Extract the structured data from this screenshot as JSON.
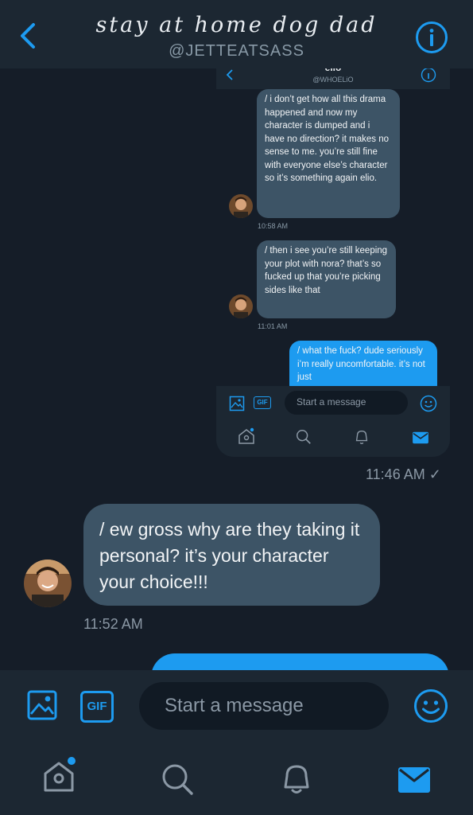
{
  "header": {
    "title": "stay at home dog dad",
    "handle": "@JETTEATSASS"
  },
  "embedded": {
    "title": "elio",
    "handle": "@WHOELiO",
    "messages": [
      {
        "direction": "in",
        "text": "/ i don’t get how all this drama happened and now my character is dumped and i have no direction? it makes no sense to me. you’re still fine with everyone else’s character so it’s something again elio.",
        "time": "10:58 AM"
      },
      {
        "direction": "in",
        "text": "/ then i see you’re still keeping your plot with nora? that’s so fucked up that you’re picking sides like that",
        "time": "11:01 AM"
      },
      {
        "direction": "out",
        "text": "/ what the fuck? dude seriously i’m really uncomfortable. it’s not just"
      }
    ],
    "compose": {
      "placeholder": "Start a message",
      "gif_label": "GIF"
    }
  },
  "chat": {
    "screenshot_time": "11:46 AM",
    "read_check": "✓",
    "incoming": {
      "text": "/ ew gross why are they taking it personal? it’s your character your choice!!!",
      "time": "11:52 AM"
    }
  },
  "compose": {
    "placeholder": "Start a message",
    "gif_label": "GIF"
  },
  "nav": {
    "items": [
      {
        "name": "home",
        "icon": "home-icon",
        "has_dot": true
      },
      {
        "name": "search",
        "icon": "search-icon"
      },
      {
        "name": "notifications",
        "icon": "bell-icon"
      },
      {
        "name": "messages",
        "icon": "mail-icon",
        "active": true
      }
    ]
  },
  "colors": {
    "accent": "#1d9bf0",
    "bubble_in": "#3d5466",
    "background": "#151d28",
    "bar": "#1c2732",
    "muted": "#8b98a5"
  }
}
